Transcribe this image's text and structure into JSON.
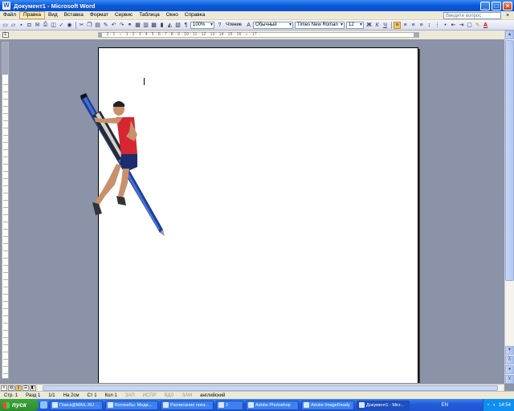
{
  "window": {
    "title": "Документ1 - Microsoft Word",
    "icon_label": "W",
    "minimize": "_",
    "maximize": "□",
    "close": "×"
  },
  "menu": {
    "items": [
      "Файл",
      "Правка",
      "Вид",
      "Вставка",
      "Формат",
      "Сервис",
      "Таблица",
      "Окно",
      "Справка"
    ],
    "active_index": 1,
    "help_placeholder": "Введите вопрос",
    "close_doc": "×"
  },
  "toolbar": {
    "zoom": "100%",
    "reading_button": "Чтение",
    "style": "Обычный",
    "font": "Times New Roman",
    "font_size": "12",
    "bold": "Ж",
    "italic": "К",
    "underline": "Ч",
    "font_color_label": "A"
  },
  "ruler": {
    "tab_selector": "L",
    "ticks": "· 2 · 1 · ⌂ · 1 · 2 · 3 · 4 · 5 · 6 · 7 · 8 · 9 · 10 · 11 · 12 · 13 · 14 · 15 · 16 · ⌂ · 17 ·"
  },
  "document": {
    "image_alt": "clip art: person climbing a large blue pen"
  },
  "scrollbar": {
    "up": "▲",
    "down": "▼",
    "prev": "⊼",
    "select": "●",
    "next": "⊻"
  },
  "status": {
    "page": "Стр. 1",
    "section": "Разд 1",
    "pages": "1/1",
    "at": "На 2см",
    "line": "Ст 1",
    "col": "Кол 1",
    "rec": "ЗАП",
    "trk": "ИСПР",
    "ext": "ВДЛ",
    "ovr": "ЗАМ",
    "language": "английский"
  },
  "taskbar": {
    "start": "пуск",
    "tasks": [
      {
        "label": "Поиск@MAIL.RU ..."
      },
      {
        "label": "Вотокибы: Меди..."
      },
      {
        "label": "Расписание поез..."
      },
      {
        "label": "2"
      },
      {
        "label": "Adobe Photoshop"
      },
      {
        "label": "Adobe ImageReady"
      },
      {
        "label": "Документ1 - Micr..."
      }
    ],
    "active_task": 6,
    "language": "EN",
    "clock": "14:54"
  }
}
